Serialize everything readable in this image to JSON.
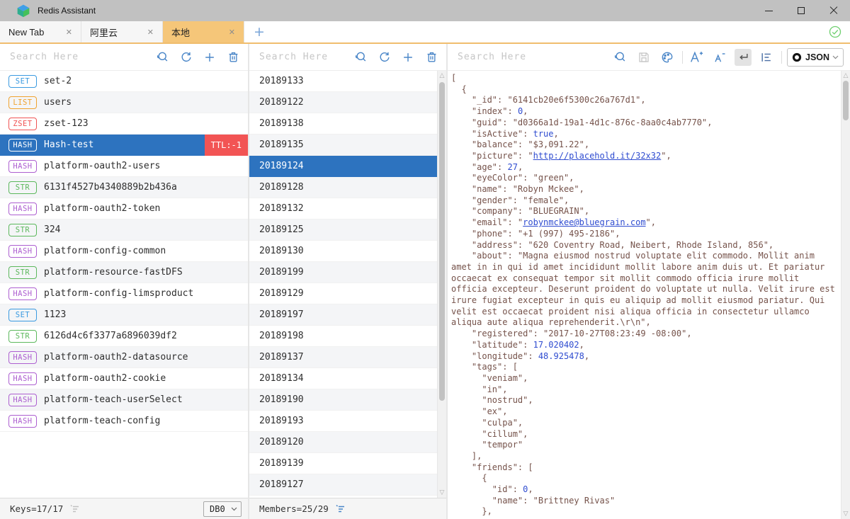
{
  "titlebar": {
    "app_title": "Redis Assistant"
  },
  "tabs": [
    {
      "label": "New Tab",
      "active": false
    },
    {
      "label": "阿里云",
      "active": false
    },
    {
      "label": "本地",
      "active": true
    }
  ],
  "icons": {
    "tab_close": "✕",
    "tab_add": "+",
    "scroll_up": "△",
    "scroll_down": "▽"
  },
  "colors": {
    "active_tab": "#f5c679",
    "selected_row": "#2d73bf",
    "ttl_badge_bg": "#f25454",
    "icon_blue": "#4a86c8",
    "json_text": "#75524a",
    "json_value": "#2f4cd0",
    "type_colors": {
      "SET": "#3a9ae0",
      "LIST": "#f0a32f",
      "ZSET": "#f05353",
      "HASH": "#ad5fd0",
      "STR": "#5cb85c"
    }
  },
  "left_panel": {
    "search_placeholder": "Search Here",
    "selected_index": 3,
    "ttl_badge": "TTL:-1",
    "keys": [
      {
        "type": "SET",
        "name": "set-2"
      },
      {
        "type": "LIST",
        "name": "users"
      },
      {
        "type": "ZSET",
        "name": "zset-123"
      },
      {
        "type": "HASH",
        "name": "Hash-test"
      },
      {
        "type": "HASH",
        "name": "platform-oauth2-users"
      },
      {
        "type": "STR",
        "name": "6131f4527b4340889b2b436a"
      },
      {
        "type": "HASH",
        "name": "platform-oauth2-token"
      },
      {
        "type": "STR",
        "name": "324"
      },
      {
        "type": "HASH",
        "name": "platform-config-common"
      },
      {
        "type": "STR",
        "name": "platform-resource-fastDFS"
      },
      {
        "type": "HASH",
        "name": "platform-config-limsproduct"
      },
      {
        "type": "SET",
        "name": "1123"
      },
      {
        "type": "STR",
        "name": "6126d4c6f3377a6896039df2"
      },
      {
        "type": "HASH",
        "name": "platform-oauth2-datasource"
      },
      {
        "type": "HASH",
        "name": "platform-oauth2-cookie"
      },
      {
        "type": "HASH",
        "name": "platform-teach-userSelect"
      },
      {
        "type": "HASH",
        "name": "platform-teach-config"
      }
    ],
    "footer": {
      "keys_label": "Keys=17/17",
      "db_selected": "DB0"
    }
  },
  "middle_panel": {
    "search_placeholder": "Search Here",
    "selected_index": 4,
    "members": [
      "20189133",
      "20189122",
      "20189138",
      "20189135",
      "20189124",
      "20189128",
      "20189132",
      "20189125",
      "20189130",
      "20189199",
      "20189129",
      "20189197",
      "20189198",
      "20189137",
      "20189134",
      "20189190",
      "20189193",
      "20189120",
      "20189139",
      "20189127"
    ],
    "footer": {
      "members_label": "Members=25/29"
    }
  },
  "right_panel": {
    "search_placeholder": "Search Here",
    "view_mode": "JSON",
    "json_lines": [
      [
        [
          "t",
          "["
        ]
      ],
      [
        [
          "t",
          "  {"
        ]
      ],
      [
        [
          "t",
          "    \"_id\": \"6141cb20e6f5300c26a767d1\","
        ]
      ],
      [
        [
          "t",
          "    \"index\": "
        ],
        [
          "v",
          "0"
        ],
        [
          "t",
          ","
        ]
      ],
      [
        [
          "t",
          "    \"guid\": \"d0366a1d-19a1-4d1c-876c-8aa0c4ab7770\","
        ]
      ],
      [
        [
          "t",
          "    \"isActive\": "
        ],
        [
          "v",
          "true"
        ],
        [
          "t",
          ","
        ]
      ],
      [
        [
          "t",
          "    \"balance\": \"$3,091.22\","
        ]
      ],
      [
        [
          "t",
          "    \"picture\": \""
        ],
        [
          "a",
          "http://placehold.it/32x32"
        ],
        [
          "t",
          "\","
        ]
      ],
      [
        [
          "t",
          "    \"age\": "
        ],
        [
          "v",
          "27"
        ],
        [
          "t",
          ","
        ]
      ],
      [
        [
          "t",
          "    \"eyeColor\": \"green\","
        ]
      ],
      [
        [
          "t",
          "    \"name\": \"Robyn Mckee\","
        ]
      ],
      [
        [
          "t",
          "    \"gender\": \"female\","
        ]
      ],
      [
        [
          "t",
          "    \"company\": \"BLUEGRAIN\","
        ]
      ],
      [
        [
          "t",
          "    \"email\": \""
        ],
        [
          "a",
          "robynmckee@bluegrain.com"
        ],
        [
          "t",
          "\","
        ]
      ],
      [
        [
          "t",
          "    \"phone\": \"+1 (997) 495-2186\","
        ]
      ],
      [
        [
          "t",
          "    \"address\": \"620 Coventry Road, Neibert, Rhode Island, 856\","
        ]
      ],
      [
        [
          "t",
          "    \"about\": \"Magna eiusmod nostrud voluptate elit commodo. Mollit anim amet in in qui id amet incididunt mollit labore anim duis ut. Et pariatur occaecat ex consequat tempor sit mollit commodo officia irure mollit officia excepteur. Deserunt proident do voluptate ut nulla. Velit irure est irure fugiat excepteur in quis eu aliquip ad mollit eiusmod pariatur. Qui velit est occaecat proident nisi aliqua officia in consectetur ullamco aliqua aute aliqua reprehenderit.\\r\\n\","
        ]
      ],
      [
        [
          "t",
          "    \"registered\": \"2017-10-27T08:23:49 -08:00\","
        ]
      ],
      [
        [
          "t",
          "    \"latitude\": "
        ],
        [
          "v",
          "17.020402"
        ],
        [
          "t",
          ","
        ]
      ],
      [
        [
          "t",
          "    \"longitude\": "
        ],
        [
          "v",
          "48.925478"
        ],
        [
          "t",
          ","
        ]
      ],
      [
        [
          "t",
          "    \"tags\": ["
        ]
      ],
      [
        [
          "t",
          "      \"veniam\","
        ]
      ],
      [
        [
          "t",
          "      \"in\","
        ]
      ],
      [
        [
          "t",
          "      \"nostrud\","
        ]
      ],
      [
        [
          "t",
          "      \"ex\","
        ]
      ],
      [
        [
          "t",
          "      \"culpa\","
        ]
      ],
      [
        [
          "t",
          "      \"cillum\","
        ]
      ],
      [
        [
          "t",
          "      \"tempor\""
        ]
      ],
      [
        [
          "t",
          "    ],"
        ]
      ],
      [
        [
          "t",
          "    \"friends\": ["
        ]
      ],
      [
        [
          "t",
          "      {"
        ]
      ],
      [
        [
          "t",
          "        \"id\": "
        ],
        [
          "v",
          "0"
        ],
        [
          "t",
          ","
        ]
      ],
      [
        [
          "t",
          "        \"name\": \"Brittney Rivas\""
        ]
      ],
      [
        [
          "t",
          "      },"
        ]
      ]
    ]
  }
}
